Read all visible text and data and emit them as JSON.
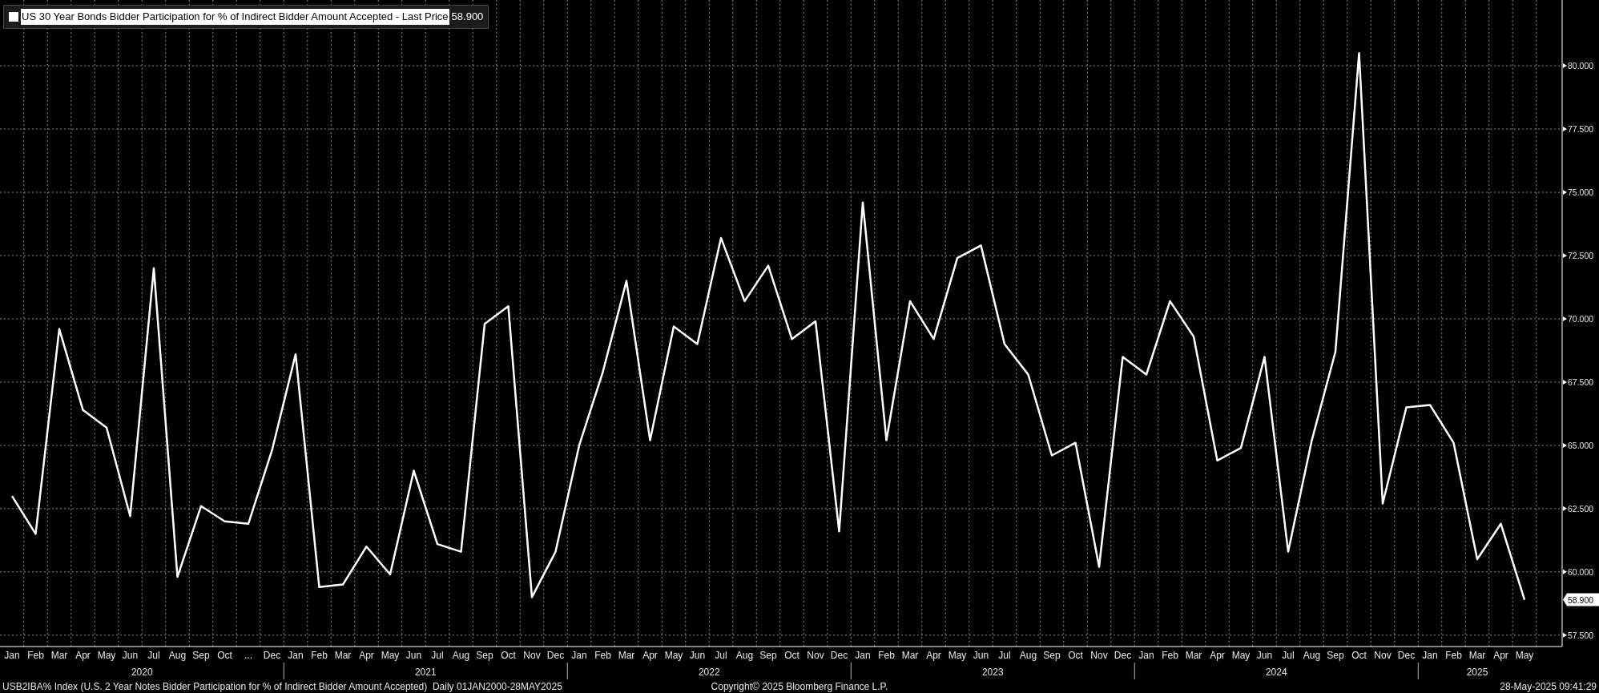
{
  "legend": {
    "checked": false,
    "last_value": "58.900"
  },
  "chart_data": {
    "type": "line",
    "grid": true,
    "categories": [
      "Jan",
      "Feb",
      "Mar",
      "Apr",
      "May",
      "Jun",
      "Jul",
      "Aug",
      "Sep",
      "Oct",
      "...",
      "Dec",
      "Jan",
      "Feb",
      "Mar",
      "Apr",
      "May",
      "Jun",
      "Jul",
      "Aug",
      "Sep",
      "Oct",
      "Nov",
      "Dec",
      "Jan",
      "Feb",
      "Mar",
      "Apr",
      "May",
      "Jun",
      "Jul",
      "Aug",
      "Sep",
      "Oct",
      "Nov",
      "Dec",
      "Jan",
      "Feb",
      "Mar",
      "Apr",
      "May",
      "Jun",
      "Jul",
      "Aug",
      "Sep",
      "Oct",
      "Nov",
      "Dec",
      "Jan",
      "Feb",
      "Mar",
      "Apr",
      "May",
      "Jun",
      "Jul",
      "Aug",
      "Sep",
      "Oct",
      "Nov",
      "Dec",
      "Jan",
      "Feb",
      "Mar",
      "Apr",
      "May"
    ],
    "series": [
      {
        "name": "US 30 Year Bonds Bidder Participation for % of Indirect Bidder Amount Accepted - Last Price",
        "color": "#ffffff",
        "values": [
          63.0,
          61.5,
          69.6,
          66.4,
          65.7,
          62.2,
          72.0,
          59.8,
          62.6,
          62.0,
          61.9,
          64.8,
          68.6,
          59.4,
          59.5,
          61.0,
          59.9,
          64.0,
          61.1,
          60.8,
          69.8,
          70.5,
          59.0,
          60.8,
          65.0,
          67.9,
          71.5,
          65.2,
          69.7,
          69.0,
          73.2,
          70.7,
          72.1,
          69.2,
          69.9,
          61.6,
          74.6,
          65.2,
          70.7,
          69.2,
          72.4,
          72.9,
          69.0,
          67.8,
          64.6,
          65.1,
          60.2,
          68.5,
          67.8,
          70.7,
          69.3,
          64.4,
          64.9,
          68.5,
          60.8,
          65.2,
          68.7,
          80.5,
          62.7,
          66.5,
          66.6,
          65.1,
          60.5,
          61.9,
          58.9
        ]
      }
    ],
    "ylim": [
      57.05,
      82.6
    ],
    "yticks": [
      {
        "value": 57.5,
        "label": "57.500"
      },
      {
        "value": 60,
        "label": "60.000"
      },
      {
        "value": 62.5,
        "label": "62.500"
      },
      {
        "value": 65,
        "label": "65.000"
      },
      {
        "value": 67.5,
        "label": "67.500"
      },
      {
        "value": 70,
        "label": "70.000"
      },
      {
        "value": 72.5,
        "label": "72.500"
      },
      {
        "value": 75,
        "label": "75.000"
      },
      {
        "value": 77.5,
        "label": "77.500"
      },
      {
        "value": 80,
        "label": "80.000"
      }
    ]
  },
  "last_price_tag": "58.900",
  "years": [
    {
      "label": "2020"
    },
    {
      "label": "2021"
    },
    {
      "label": "2022"
    },
    {
      "label": "2023"
    },
    {
      "label": "2024"
    },
    {
      "label": "2025"
    }
  ],
  "footer": {
    "left": "USB2IBA% Index (U.S. 2 Year Notes Bidder Participation for % of Indirect Bidder Amount Accepted)  Daily 01JAN2000-28MAY2025",
    "center": "Copyright© 2025 Bloomberg Finance L.P.",
    "right": "28-May-2025 09:41:29"
  }
}
